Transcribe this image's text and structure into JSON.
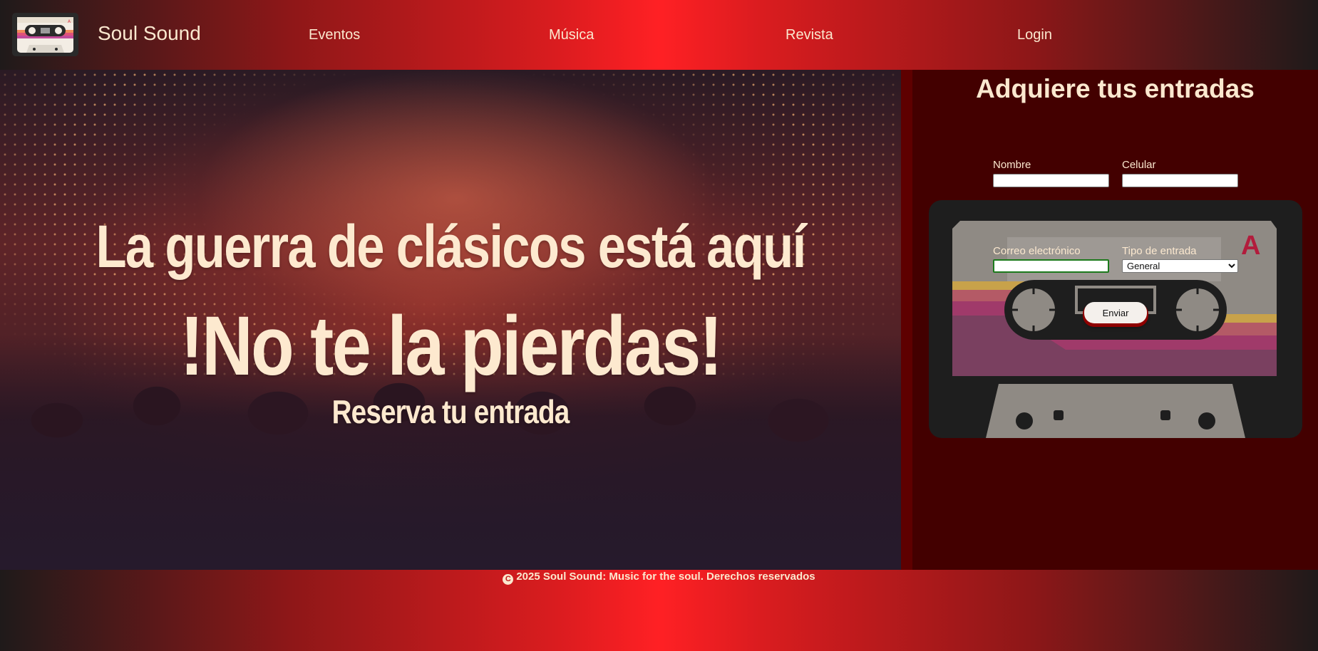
{
  "header": {
    "brand": "Soul Sound",
    "logo_icon": "cassette-logo-icon",
    "nav": [
      {
        "label": "Eventos"
      },
      {
        "label": "Música"
      },
      {
        "label": "Revista"
      },
      {
        "label": "Login"
      }
    ]
  },
  "hero": {
    "headline": "La guerra de clásicos está aquí",
    "tagline": "!No te la pierdas!",
    "cta_text": "Reserva tu entrada"
  },
  "form": {
    "title": "Adquiere tus entradas",
    "name_label": "Nombre",
    "name_value": "",
    "phone_label": "Celular",
    "phone_value": "",
    "email_label": "Correo electrónico",
    "email_value": "",
    "ticket_label": "Tipo de entrada",
    "ticket_selected": "General",
    "submit_label": "Enviar",
    "cassette_badge": "A"
  },
  "footer": {
    "copyright_icon": "copyright-icon",
    "text": "2025 Soul Sound: Music for the soul. Derechos reservados"
  },
  "colors": {
    "cream": "#fbe8cf",
    "header_red": "#ff2024",
    "panel_bg": "#430000",
    "cassette_body": "#1e1e1e"
  }
}
